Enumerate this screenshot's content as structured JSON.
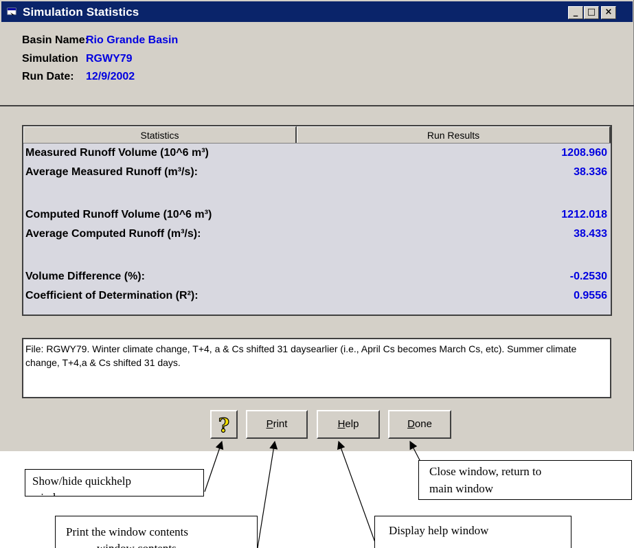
{
  "window": {
    "title": "Simulation Statistics",
    "controls": {
      "minimize": "_",
      "maximize": "□",
      "close": "×"
    }
  },
  "info": {
    "basin_label": "Basin Name:",
    "basin_value": "Rio Grande Basin",
    "simulation_label": "Simulation",
    "simulation_value": "RGWY79",
    "run_date_label": "Run Date:",
    "run_date_value": "12/9/2002"
  },
  "table": {
    "headers": [
      "Statistics",
      "Run Results"
    ],
    "rows": [
      {
        "label": "Measured Runoff Volume (10^6 m³)",
        "value": "1208.960"
      },
      {
        "label": "Average Measured Runoff (m³/s):",
        "value": "38.336"
      },
      {
        "label": "Computed Runoff Volume (10^6 m³)",
        "value": "1212.018"
      },
      {
        "label": "Average Computed Runoff  (m³/s):",
        "value": "38.433"
      },
      {
        "label": "Volume Difference (%):",
        "value": "-0.2530"
      },
      {
        "label": "Coefficient of Determination (R²):",
        "value": "0.9556"
      }
    ]
  },
  "notes_text": "File:  RGWY79.  Winter climate change, T+4, a & Cs shifted 31 daysearlier (i.e., April Cs becomes March Cs, etc).  Summer climate change, T+4,a & Cs shifted 31 days.",
  "buttons": {
    "quickhelp_glyph": "?",
    "print_label_underlined": "P",
    "print_label_rest": "rint",
    "help_label_underlined": "H",
    "help_label_rest": "elp",
    "done_label_underlined": "D",
    "done_label_rest": "one"
  },
  "callouts": {
    "quickhelp_line1": "Show/hide quickhelp",
    "quickhelp_line2": "window",
    "close_line1": "Close window, return to",
    "close_line2": "main window",
    "print_line1": "Print the window contents",
    "print_line2": "window contents",
    "help_line1": "Display help window"
  },
  "colors": {
    "titlebar": "#0a246a",
    "value_text": "#0000e0",
    "window_bg": "#d4d0c8"
  }
}
